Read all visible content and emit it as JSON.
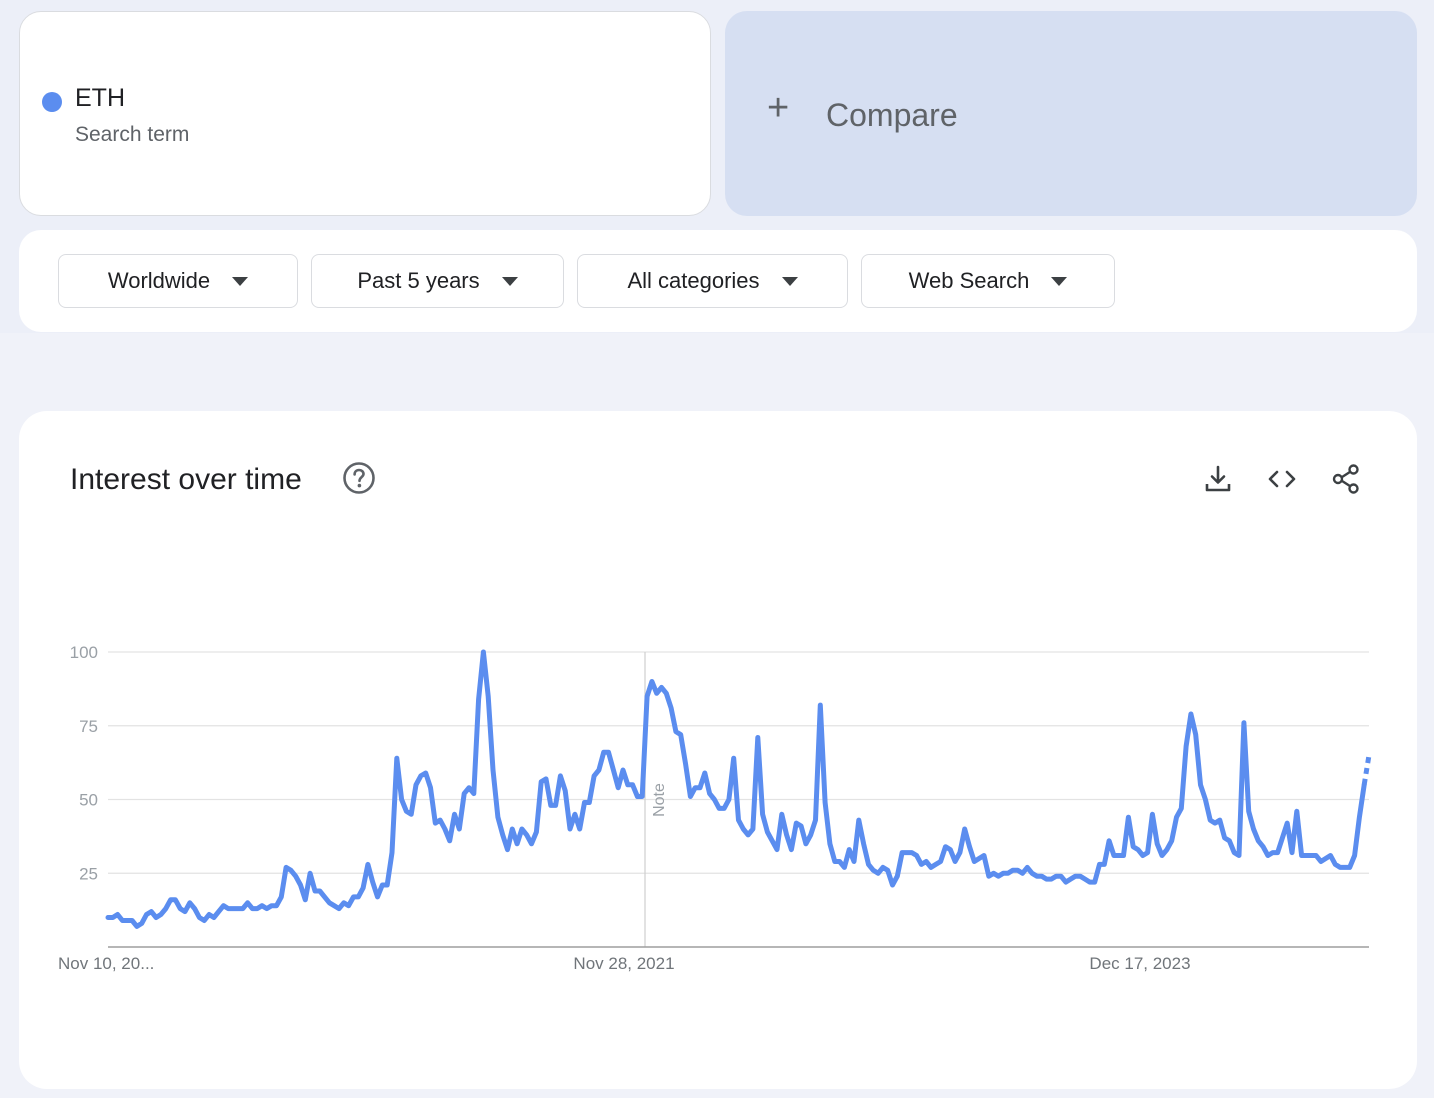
{
  "search_term": {
    "name": "ETH",
    "label": "Search term",
    "color": "#5b8def"
  },
  "compare": {
    "plus": "+",
    "label": "Compare"
  },
  "filters": [
    {
      "label": "Worldwide"
    },
    {
      "label": "Past 5 years"
    },
    {
      "label": "All categories"
    },
    {
      "label": "Web Search"
    }
  ],
  "chart_panel": {
    "title": "Interest over time",
    "icons": [
      "help-icon",
      "download-icon",
      "embed-icon",
      "share-icon"
    ],
    "note_label": "Note"
  },
  "chart_data": {
    "type": "line",
    "x_tick_labels": [
      "Nov 10, 20...",
      "Nov 28, 2021",
      "Dec 17, 2023"
    ],
    "y_ticks": [
      25,
      50,
      75,
      100
    ],
    "ylim": [
      0,
      100
    ],
    "grid": true,
    "series": [
      {
        "name": "ETH",
        "color": "#5b8def",
        "partial_last_point": true,
        "values": [
          10,
          10,
          11,
          9,
          9,
          9,
          7,
          8,
          11,
          12,
          10,
          11,
          13,
          16,
          16,
          13,
          12,
          15,
          13,
          10,
          9,
          11,
          10,
          12,
          14,
          13,
          13,
          13,
          13,
          15,
          13,
          13,
          14,
          13,
          14,
          14,
          17,
          27,
          26,
          24,
          21,
          16,
          25,
          19,
          19,
          17,
          15,
          14,
          13,
          15,
          14,
          17,
          17,
          20,
          28,
          22,
          17,
          21,
          21,
          32,
          64,
          50,
          46,
          45,
          55,
          58,
          59,
          54,
          42,
          43,
          40,
          36,
          45,
          40,
          52,
          54,
          52,
          84,
          100,
          85,
          60,
          44,
          38,
          33,
          40,
          35,
          40,
          38,
          35,
          39,
          56,
          57,
          48,
          48,
          58,
          53,
          40,
          45,
          40,
          49,
          49,
          58,
          60,
          66,
          66,
          60,
          54,
          60,
          55,
          55,
          51,
          51,
          85,
          90,
          86,
          88,
          86,
          81,
          73,
          72,
          62,
          51,
          54,
          54,
          59,
          52,
          50,
          47,
          47,
          50,
          64,
          43,
          40,
          38,
          40,
          71,
          45,
          39,
          36,
          33,
          45,
          38,
          33,
          42,
          41,
          35,
          38,
          43,
          82,
          49,
          35,
          29,
          29,
          27,
          33,
          29,
          43,
          35,
          28,
          26,
          25,
          27,
          26,
          21,
          24,
          32,
          32,
          32,
          31,
          28,
          29,
          27,
          28,
          29,
          34,
          33,
          29,
          32,
          40,
          34,
          29,
          30,
          31,
          24,
          25,
          24,
          25,
          25,
          26,
          26,
          25,
          27,
          25,
          24,
          24,
          23,
          23,
          24,
          24,
          22,
          23,
          24,
          24,
          23,
          22,
          22,
          28,
          28,
          36,
          31,
          31,
          31,
          44,
          34,
          33,
          31,
          32,
          45,
          35,
          31,
          33,
          36,
          44,
          47,
          68,
          79,
          72,
          55,
          50,
          43,
          42,
          43,
          37,
          36,
          32,
          31,
          76,
          46,
          40,
          36,
          34,
          31,
          32,
          32,
          37,
          42,
          32,
          46,
          31,
          31,
          31,
          31,
          29,
          30,
          31,
          28,
          27,
          27,
          27,
          31,
          44,
          55,
          65
        ]
      }
    ]
  }
}
